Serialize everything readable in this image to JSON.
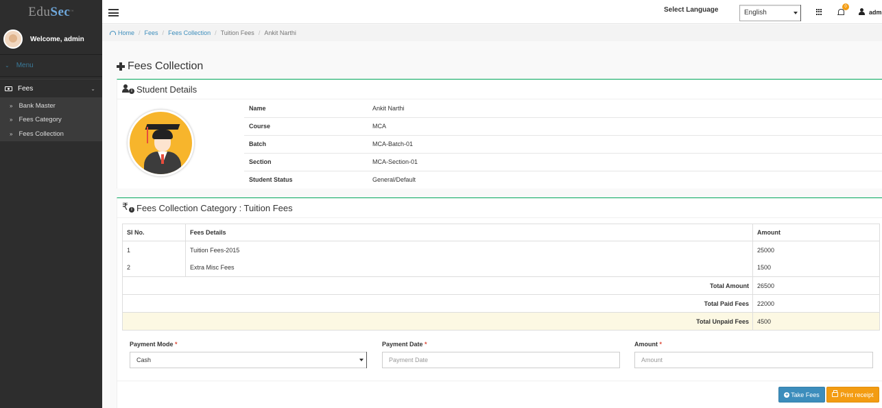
{
  "app": {
    "logo_main": "Edu",
    "logo_accent": "Sec",
    "logo_tm": "™"
  },
  "sidebar": {
    "welcome": "Welcome, admin",
    "menu_header": "Menu",
    "fees_label": "Fees",
    "items": [
      {
        "label": "Bank Master"
      },
      {
        "label": "Fees Category"
      },
      {
        "label": "Fees Collection"
      }
    ]
  },
  "topbar": {
    "language_label": "Select Language",
    "language_value": "English",
    "notification_count": "0",
    "user_name": "admin"
  },
  "breadcrumb": {
    "home": "Home",
    "fees": "Fees",
    "fees_collection": "Fees Collection",
    "tuition_fees": "Tuition Fees",
    "student": "Ankit Narthi"
  },
  "page": {
    "title": "Fees Collection"
  },
  "student_details": {
    "title": "Student Details",
    "rows": [
      {
        "key": "Name",
        "value": "Ankit Narthi"
      },
      {
        "key": "Course",
        "value": "MCA"
      },
      {
        "key": "Batch",
        "value": "MCA-Batch-01"
      },
      {
        "key": "Section",
        "value": "MCA-Section-01"
      },
      {
        "key": "Student Status",
        "value": "General/Default"
      }
    ]
  },
  "fees_category": {
    "title": "Fees Collection Category : Tuition Fees",
    "headers": {
      "sl": "SI No.",
      "details": "Fees Details",
      "amount": "Amount"
    },
    "rows": [
      {
        "sl": "1",
        "details": "Tuition Fees-2015",
        "amount": "25000"
      },
      {
        "sl": "2",
        "details": "Extra Misc Fees",
        "amount": "1500"
      }
    ],
    "totals": [
      {
        "label": "Total Amount",
        "value": "26500"
      },
      {
        "label": "Total Paid Fees",
        "value": "22000"
      },
      {
        "label": "Total Unpaid Fees",
        "value": "4500"
      }
    ]
  },
  "form": {
    "payment_mode_label": "Payment Mode",
    "payment_mode_value": "Cash",
    "payment_date_label": "Payment Date",
    "payment_date_placeholder": "Payment Date",
    "amount_label": "Amount",
    "amount_placeholder": "Amount",
    "required_mark": "*"
  },
  "actions": {
    "take_fees": "Take Fees",
    "print_receipt": "Print receipt"
  },
  "colors": {
    "accent": "#3c8dbc",
    "box_top": "#00a65a",
    "warning": "#f39c12",
    "highlight_row": "#fcf8e3"
  }
}
